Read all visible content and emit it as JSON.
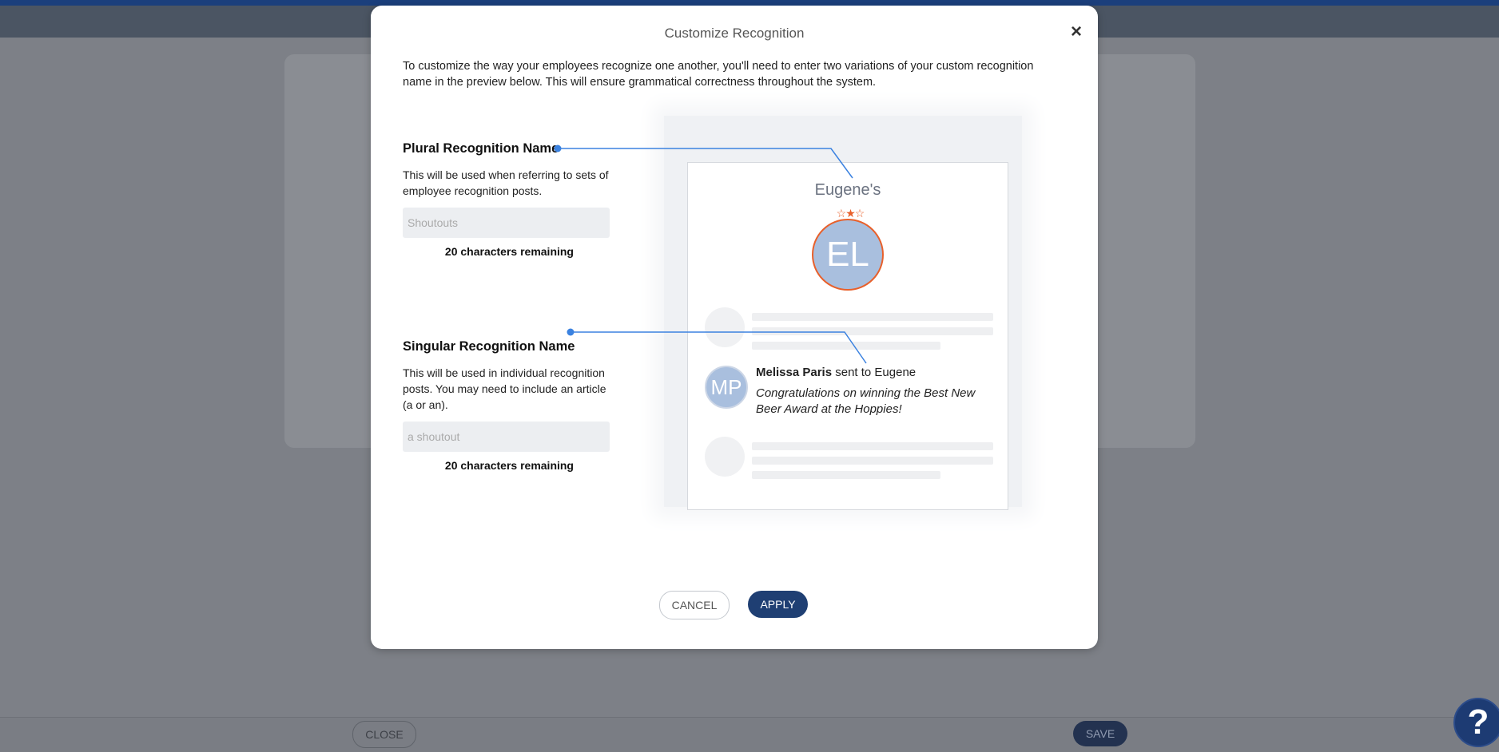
{
  "background": {
    "close_label": "CLOSE",
    "save_label": "SAVE",
    "help_label": "?"
  },
  "modal": {
    "title": "Customize Recognition",
    "close_icon": "×",
    "intro": "To customize the way your employees recognize one another, you'll need to enter two variations of your custom recognition name in the preview below. This will ensure grammatical correctness throughout the system.",
    "plural": {
      "title": "Plural Recognition Name",
      "description": "This will be used when referring to sets of employee recognition posts.",
      "placeholder": "Shoutouts",
      "value": "",
      "remaining": "20 characters remaining"
    },
    "singular": {
      "title": "Singular Recognition Name",
      "description": "This will be used in individual recognition posts. You may need to include an article (a or an).",
      "placeholder": "a shoutout",
      "value": "",
      "remaining": "20 characters remaining"
    },
    "preview": {
      "name": "Eugene's",
      "avatar_initials": "EL",
      "stars": "☆★☆",
      "post_avatar_initials": "MP",
      "post_sender": "Melissa Paris",
      "post_action": " sent to Eugene",
      "post_message": "Congratulations on winning the Best New Beer Award at the Hoppies!"
    },
    "cancel_label": "CANCEL",
    "apply_label": "APPLY"
  },
  "colors": {
    "accent": "#1f3f73",
    "connector": "#3b82e0",
    "star": "#e8602b"
  }
}
